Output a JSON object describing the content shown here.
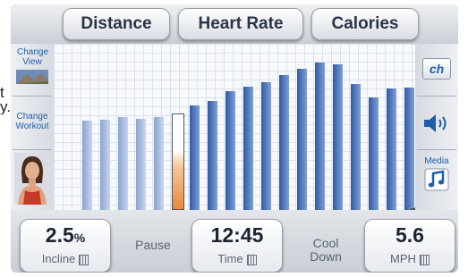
{
  "background": {
    "lines": [
      "t",
      "y."
    ]
  },
  "tabs": {
    "distance": "Distance",
    "heart_rate": "Heart Rate",
    "calories": "Calories"
  },
  "left_panel": {
    "change_view": "Change View",
    "change_workout": "Change Workout"
  },
  "right_panel": {
    "channel": "ch",
    "media": "Media"
  },
  "chart_data": {
    "type": "bar",
    "values": [
      75,
      76,
      78,
      77,
      78,
      80,
      88,
      92,
      100,
      104,
      108,
      114,
      119,
      124,
      123,
      106,
      95,
      102,
      103
    ],
    "current_index": 5,
    "colors": {
      "past": "#9bb0d8",
      "future": "#3a64ad",
      "current": "#e9883e"
    }
  },
  "bottom": {
    "incline": {
      "value": "2.5",
      "unit": "%",
      "label": "Incline"
    },
    "pause": "Pause",
    "time": {
      "value": "12:45",
      "label": "Time"
    },
    "cool_down": "Cool Down",
    "speed": {
      "value": "5.6",
      "label": "MPH"
    }
  }
}
